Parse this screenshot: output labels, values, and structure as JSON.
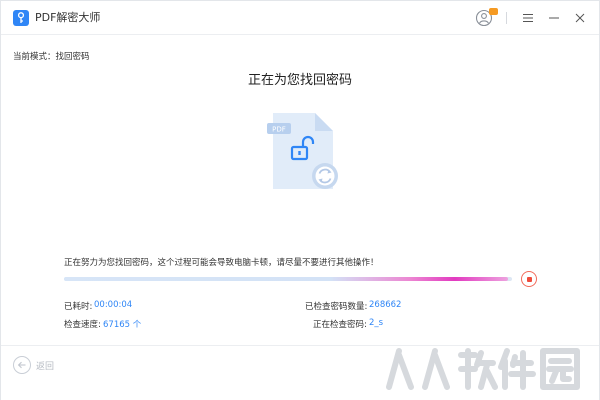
{
  "titlebar": {
    "app_title": "PDF解密大师",
    "icons": [
      "app-key-icon",
      "user-icon",
      "menu-icon",
      "minimize-icon",
      "close-icon"
    ]
  },
  "main": {
    "mode_label": "当前模式：找回密码",
    "heading": "正在为您找回密码",
    "illustration": {
      "file_label": "PDF"
    },
    "status_text": "正在努力为您找回密码，这个过程可能会导致电脑卡顿，请尽量不要进行其他操作！",
    "progress_fraction": 0.99,
    "stats": {
      "elapsed_label": "已耗时:",
      "elapsed_value": "00:00:04",
      "speed_label": "检查速度:",
      "speed_value": "67165 个",
      "checked_label": "已检查密码数量:",
      "checked_value": "268662",
      "current_label": "正在检查密码:",
      "current_value": "2_s"
    }
  },
  "footer": {
    "back_label": "返回"
  },
  "watermark": {
    "text": "人人软件园"
  },
  "colors": {
    "accent": "#2f86f6",
    "progress_pink": "#e23bc0",
    "stop_red": "#ef4b3b",
    "vip_orange": "#f59a23"
  }
}
